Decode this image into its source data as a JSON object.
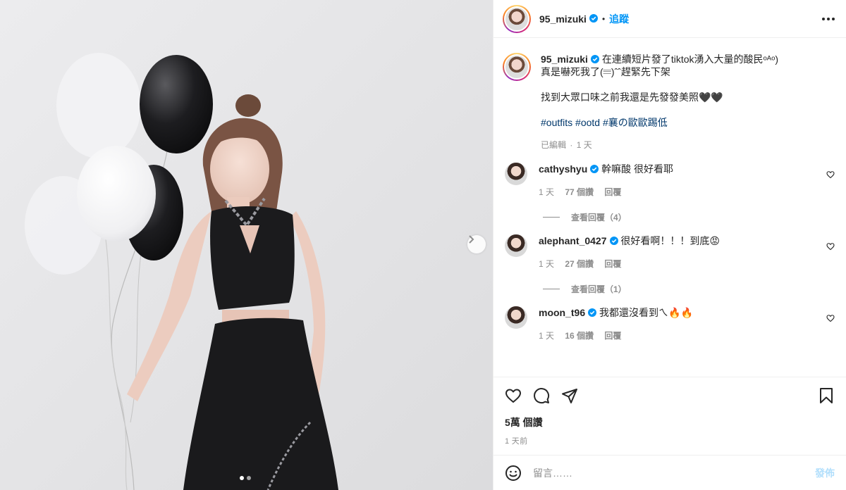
{
  "post": {
    "username": "95_mizuki",
    "follow_label": "追蹤",
    "separator": "•"
  },
  "caption": {
    "username": "95_mizuki",
    "line1": "在連續短片發了tiktok湧入大量的酸民ᵒᴬᵒ)",
    "line2": "真是嚇死我了(𝄘)ˆˆ趕緊先下架",
    "line3": "找到大眾口味之前我還是先發發美照🖤🖤",
    "hashtags": [
      "#outfits",
      "#ootd",
      "#襄の歐歐踢低"
    ],
    "edited": "已編輯",
    "dot": "·",
    "time": "1 天"
  },
  "comments": [
    {
      "username": "cathyshyu",
      "text": "幹嘛酸 很好看耶",
      "time": "1 天",
      "likes": "77 個讚",
      "reply": "回覆",
      "view_replies": "查看回覆（4）"
    },
    {
      "username": "alephant_0427",
      "text": "很好看啊！！！到底😡",
      "time": "1 天",
      "likes": "27 個讚",
      "reply": "回覆",
      "view_replies": "查看回覆（1）"
    },
    {
      "username": "moon_t96",
      "text": "我都還沒看到ㄟ🔥🔥",
      "time": "1 天",
      "likes": "16 個讚",
      "reply": "回覆"
    }
  ],
  "stats": {
    "views": "5萬 個讚",
    "posted": "1 天前"
  },
  "composer": {
    "placeholder": "留言……",
    "post_label": "發佈"
  },
  "carousel": {
    "total": 2,
    "current": 1
  },
  "icons": [
    "verified-icon",
    "more-icon",
    "heart-icon",
    "comment-icon",
    "share-icon",
    "save-icon",
    "emoji-icon",
    "chevron-right-icon"
  ],
  "colors": {
    "accent": "#0095f6",
    "hashtag": "#00376b",
    "muted": "#8e8e8e",
    "post_disabled": "#b2dffc"
  }
}
